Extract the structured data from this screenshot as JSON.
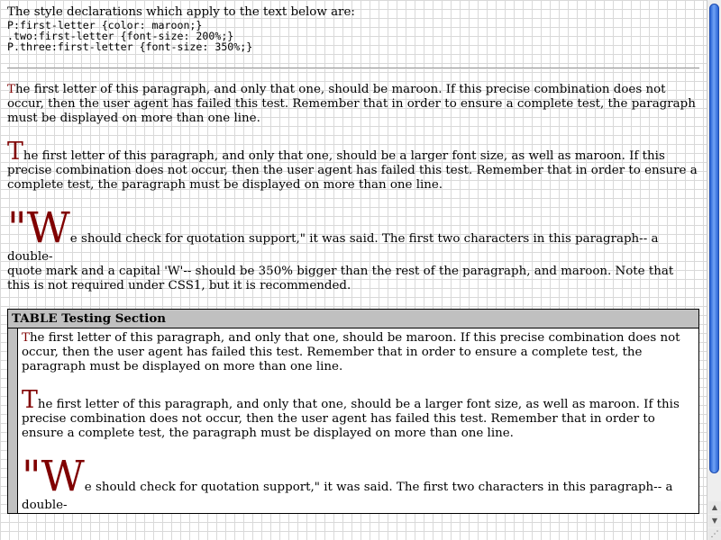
{
  "intro_text": "The style declarations which apply to the text below are:",
  "code_lines": [
    "P:first-letter {color: maroon;}",
    ".two:first-letter {font-size: 200%;}",
    "P.three:first-letter {font-size: 350%;}"
  ],
  "p1": {
    "first": "T",
    "rest": "he first letter of this paragraph, and only that one, should be maroon. If this precise combination does not occur, then the user agent has failed this test. Remember that in order to ensure a complete test, the paragraph must be displayed on more than one line."
  },
  "p2": {
    "first": "T",
    "rest": "he first letter of this paragraph, and only that one, should be a larger font size, as well as maroon. If this precise combination does not occur, then the user agent has failed this test. Remember that in order to ensure a complete test, the paragraph must be displayed on more than one line."
  },
  "p3": {
    "first": "\"W",
    "rest_line1": "e should check for quotation support,\" it was said. The first two characters in this paragraph-- a double-",
    "rest": "quote mark and a capital 'W'-- should be 350% bigger than the rest of the paragraph, and maroon. Note that this is not required under CSS1, but it is recommended."
  },
  "table": {
    "header": "TABLE Testing Section",
    "p1": {
      "first": "T",
      "rest": "he first letter of this paragraph, and only that one, should be maroon. If this precise combination does not occur, then the user agent has failed this test. Remember that in order to ensure a complete test, the paragraph must be displayed on more than one line."
    },
    "p2": {
      "first": "T",
      "rest": "he first letter of this paragraph, and only that one, should be a larger font size, as well as maroon. If this precise combination does not occur, then the user agent has failed this test. Remember that in order to ensure a complete test, the paragraph must be displayed on more than one line."
    },
    "p3": {
      "first": "\"W",
      "rest_line1": "e should check for quotation support,\" it was said. The first two characters in this paragraph-- a double-"
    }
  },
  "colors": {
    "first_letter": "#800000",
    "table_header_bg": "#c0c0c0",
    "scrollbar_thumb": "#2a63d4"
  },
  "icons": {
    "scroll_up": "scroll-up-arrow-icon",
    "scroll_down": "scroll-down-arrow-icon"
  }
}
